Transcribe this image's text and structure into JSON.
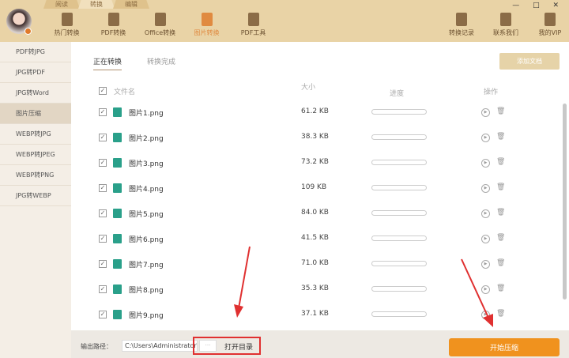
{
  "top_tabs": [
    "阅读",
    "转换",
    "编辑"
  ],
  "tools": [
    {
      "label": "热门转换",
      "icon": "star-doc-icon"
    },
    {
      "label": "PDF转换",
      "icon": "pdf-icon"
    },
    {
      "label": "Office转换",
      "icon": "doc-icon"
    },
    {
      "label": "图片转换",
      "icon": "image-icon"
    },
    {
      "label": "PDF工具",
      "icon": "toolbox-icon"
    }
  ],
  "right_tools": [
    {
      "label": "转换记录",
      "icon": "clock-icon"
    },
    {
      "label": "联系我们",
      "icon": "headset-icon"
    },
    {
      "label": "我的VIP",
      "icon": "crown-icon"
    }
  ],
  "window_controls": "— □ ✕",
  "sidebar": [
    "PDF转JPG",
    "JPG转PDF",
    "JPG转Word",
    "图片压缩",
    "WEBP转JPG",
    "WEBP转JPEG",
    "WEBP转PNG",
    "JPG转WEBP"
  ],
  "tabs": {
    "active": "正在转换",
    "done": "转换完成"
  },
  "add_button": "添加文档",
  "columns": {
    "name": "文件名",
    "size": "大小",
    "progress": "进度",
    "action": "操作"
  },
  "files": [
    {
      "name": "图片1.png",
      "size": "61.2 KB"
    },
    {
      "name": "图片2.png",
      "size": "38.3 KB"
    },
    {
      "name": "图片3.png",
      "size": "73.2 KB"
    },
    {
      "name": "图片4.png",
      "size": "109 KB"
    },
    {
      "name": "图片5.png",
      "size": "84.0 KB"
    },
    {
      "name": "图片6.png",
      "size": "41.5 KB"
    },
    {
      "name": "图片7.png",
      "size": "71.0 KB"
    },
    {
      "name": "图片8.png",
      "size": "35.3 KB"
    },
    {
      "name": "图片9.png",
      "size": "37.1 KB"
    }
  ],
  "bottom": {
    "label": "输出路径：",
    "path": "C:\\Users\\Administrator\\",
    "browse": "···",
    "open_dir": "打开目录",
    "start": "开始压缩"
  }
}
